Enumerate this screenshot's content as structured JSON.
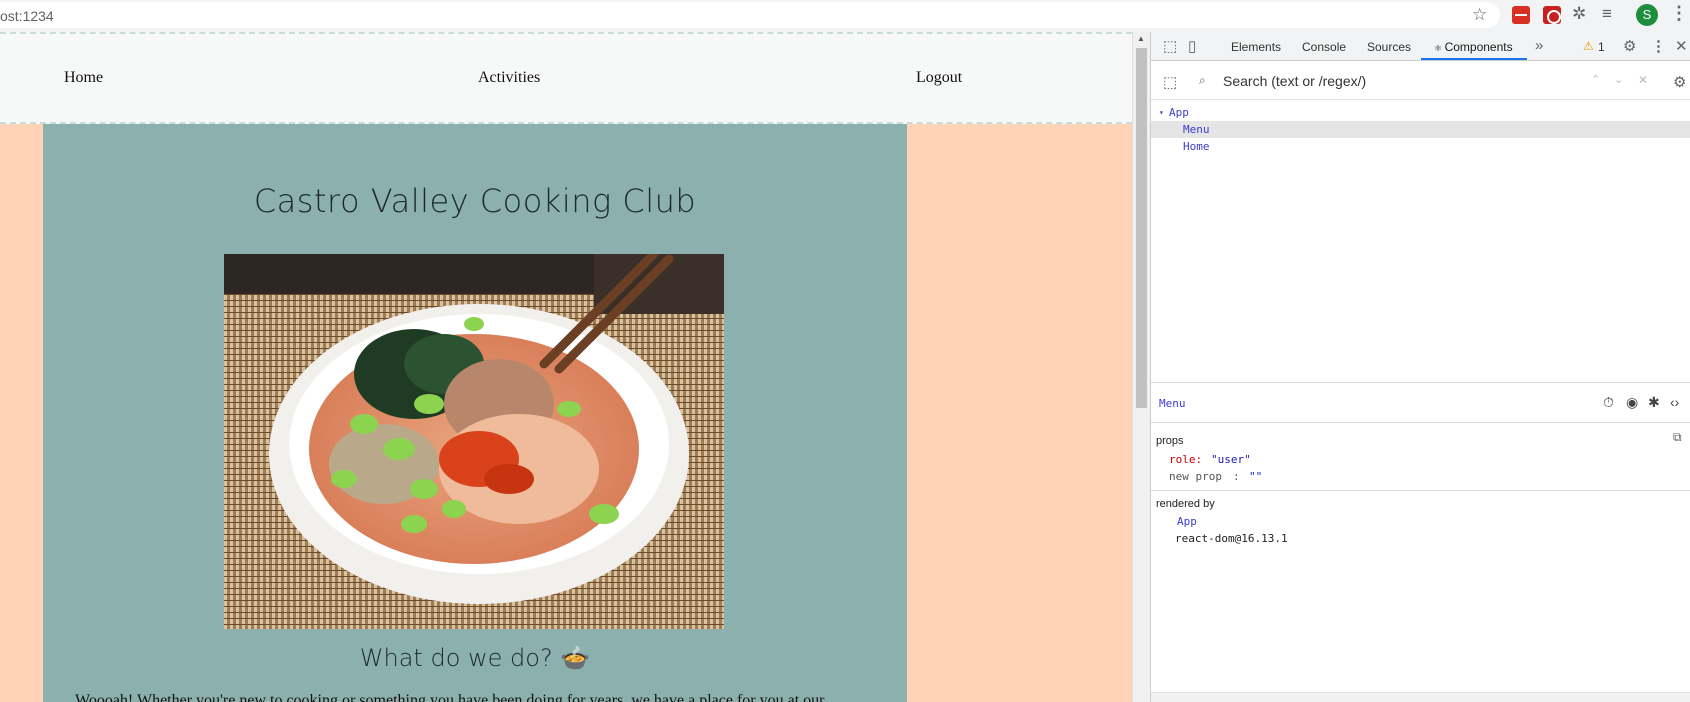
{
  "browser": {
    "url": "ost:1234",
    "avatar_letter": "S"
  },
  "page": {
    "nav": {
      "home": "Home",
      "activities": "Activities",
      "logout": "Logout"
    },
    "title": "Castro Valley Cooking Club",
    "hero_image_alt": "poke bowl photo",
    "subtitle": "What do we do? 🍲",
    "intro_text": "Woooah! Whether you're new to cooking or something you have been doing for years, we have a place for you at our...",
    "colors": {
      "background": "#ffd3b5",
      "content": "#8cb0ad",
      "navbar": "#f7f8f8"
    }
  },
  "devtools": {
    "tabs": [
      "Elements",
      "Console",
      "Sources",
      "Components"
    ],
    "active_tab": "Components",
    "warning_count": "1",
    "search_placeholder": "Search (text or /regex/)",
    "tree": {
      "root": "App",
      "children": [
        "Menu",
        "Home"
      ]
    },
    "selected_component": "Menu",
    "props_label": "props",
    "props": {
      "role_key": "role:",
      "role_value": "\"user\"",
      "new_prop_key": "new prop",
      "new_prop_sep": ":",
      "new_prop_value": "\"\""
    },
    "rendered_by_label": "rendered by",
    "rendered_by": [
      "App",
      "react-dom@16.13.1"
    ]
  }
}
